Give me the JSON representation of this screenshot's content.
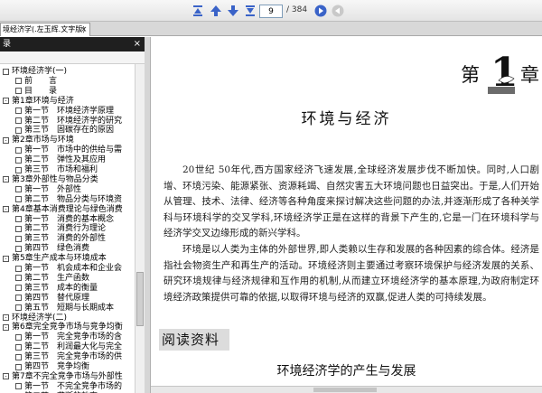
{
  "toolbar": {
    "page_current": "9",
    "page_total": "/ 384",
    "accent": "#3a63c8"
  },
  "tab": {
    "title": "境经济学(.左玉辉.文字版)",
    "close": "×"
  },
  "sidebar": {
    "header": "录",
    "close": "×",
    "items": [
      {
        "label": "环境经济学(一)",
        "indent": 0,
        "mark": ""
      },
      {
        "label": "前　　言",
        "indent": 1,
        "mark": ""
      },
      {
        "label": "目　　录",
        "indent": 1,
        "mark": ""
      },
      {
        "label": "第1章环境与经济",
        "indent": 0,
        "mark": "-"
      },
      {
        "label": "第一节　环境经济学原理",
        "indent": 1,
        "mark": ""
      },
      {
        "label": "第二节　环境经济学的研究",
        "indent": 1,
        "mark": ""
      },
      {
        "label": "第三节　固碳存在的原因",
        "indent": 1,
        "mark": ""
      },
      {
        "label": "第2章市场与环境",
        "indent": 0,
        "mark": "-"
      },
      {
        "label": "第一节　市场中的供给与需",
        "indent": 1,
        "mark": ""
      },
      {
        "label": "第二节　弹性及其应用",
        "indent": 1,
        "mark": ""
      },
      {
        "label": "第三节　市场和福利",
        "indent": 1,
        "mark": ""
      },
      {
        "label": "第3章外部性与物品分类",
        "indent": 0,
        "mark": "-"
      },
      {
        "label": "第一节　外部性",
        "indent": 1,
        "mark": ""
      },
      {
        "label": "第二节　物品分类与环境资",
        "indent": 1,
        "mark": ""
      },
      {
        "label": "第4章基本消费理论与绿色消费",
        "indent": 0,
        "mark": "-"
      },
      {
        "label": "第一节　消费的基本概念",
        "indent": 1,
        "mark": ""
      },
      {
        "label": "第二节　消费行为理论",
        "indent": 1,
        "mark": ""
      },
      {
        "label": "第三节　消费的外部性",
        "indent": 1,
        "mark": ""
      },
      {
        "label": "第四节　绿色消费",
        "indent": 1,
        "mark": ""
      },
      {
        "label": "第5章生产成本与环境成本",
        "indent": 0,
        "mark": "-"
      },
      {
        "label": "第一节　机会成本和企业会",
        "indent": 1,
        "mark": ""
      },
      {
        "label": "第二节　生产函数",
        "indent": 1,
        "mark": ""
      },
      {
        "label": "第三节　成本的衡量",
        "indent": 1,
        "mark": ""
      },
      {
        "label": "第四节　替代原理",
        "indent": 1,
        "mark": ""
      },
      {
        "label": "第五节　短期与长期成本",
        "indent": 1,
        "mark": ""
      },
      {
        "label": "环境经济学(二)",
        "indent": 0,
        "mark": "-"
      },
      {
        "label": "第6章完全竞争市场与竞争均衡",
        "indent": 0,
        "mark": "-"
      },
      {
        "label": "第一节　完全竞争市场的含",
        "indent": 1,
        "mark": ""
      },
      {
        "label": "第二节　利润最大化与完全",
        "indent": 1,
        "mark": ""
      },
      {
        "label": "第三节　完全竞争市场的供",
        "indent": 1,
        "mark": ""
      },
      {
        "label": "第四节　竞争均衡",
        "indent": 1,
        "mark": ""
      },
      {
        "label": "第7章不完全竞争市场与外部性",
        "indent": 0,
        "mark": "-"
      },
      {
        "label": "第一节　不完全竞争市场的",
        "indent": 1,
        "mark": ""
      },
      {
        "label": "第二节　垄断的效率",
        "indent": 1,
        "mark": ""
      }
    ]
  },
  "document": {
    "chapter_prefix": "第",
    "chapter_number": "1",
    "chapter_suffix": "章",
    "title": "环境与经济",
    "para1": "20世纪 50年代,西方国家经济飞速发展,全球经济发展步伐不断加快。同时,人口剧增、环境污染、能源紧张、资源耗竭、自然灾害五大环境问题也日益突出。于是,人们开始从管理、技术、法律、经济等各种角度来探讨解决这些问题的办法,并逐渐形成了各种关学科与环境科学的交叉学科,环境经济学正是在这样的背景下产生的,它是一门在环境科学与经济学交叉边缘形成的新兴学科。",
    "para2": "环境是以人类为主体的外部世界,即人类赖以生存和发展的各种因素的综合体。经济是指社会物资生产和再生产的活动。环境经济则主要通过考察环境保护与经济发展的关系、研究环境规律与经济规律和互作用的机制,从而建立环境经济学的基本原理,为政府制定环境经济政策提供可靠的依据,以取得环境与经济的双赢,促进人类的可持续发展。",
    "reading_heading": "阅读资料",
    "reading_title": "环境经济学的产生与发展"
  }
}
